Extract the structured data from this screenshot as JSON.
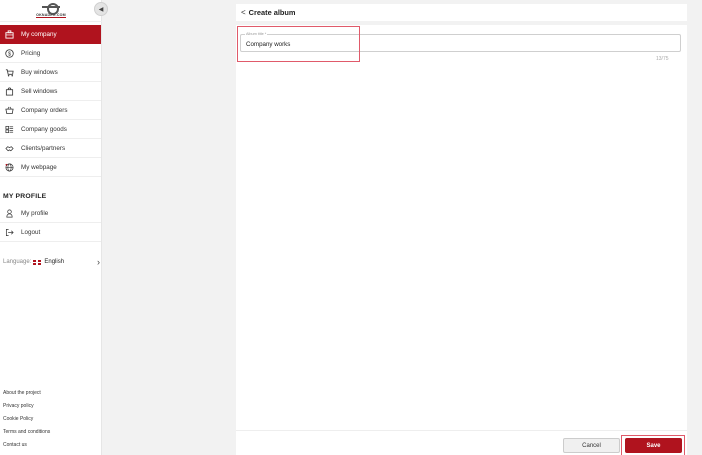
{
  "app": {
    "logo_text": "OKNADER.COM"
  },
  "sidebar": {
    "items": [
      {
        "label": "My company",
        "icon": "briefcase-icon",
        "active": true
      },
      {
        "label": "Pricing",
        "icon": "dollar-icon"
      },
      {
        "label": "Buy windows",
        "icon": "cart-icon"
      },
      {
        "label": "Sell windows",
        "icon": "bag-icon"
      },
      {
        "label": "Company orders",
        "icon": "basket-icon"
      },
      {
        "label": "Company goods",
        "icon": "list-icon"
      },
      {
        "label": "Clients/partners",
        "icon": "handshake-icon"
      },
      {
        "label": "My webpage",
        "icon": "globe-icon"
      }
    ],
    "profile_title": "MY PROFILE",
    "profile_items": [
      {
        "label": "My profile",
        "icon": "user-icon"
      },
      {
        "label": "Logout",
        "icon": "logout-icon"
      }
    ],
    "language_label": "Language:",
    "language_value": "English",
    "footer_links": [
      "About the project",
      "Privacy policy",
      "Cookie Policy",
      "Terms and conditions",
      "Contact us"
    ]
  },
  "header": {
    "title": "Create album"
  },
  "form": {
    "album_label": "Album title *",
    "album_value": "Company works",
    "counter": "13/75"
  },
  "actions": {
    "cancel": "Cancel",
    "save": "Save"
  },
  "colors": {
    "accent": "#b0131e"
  }
}
